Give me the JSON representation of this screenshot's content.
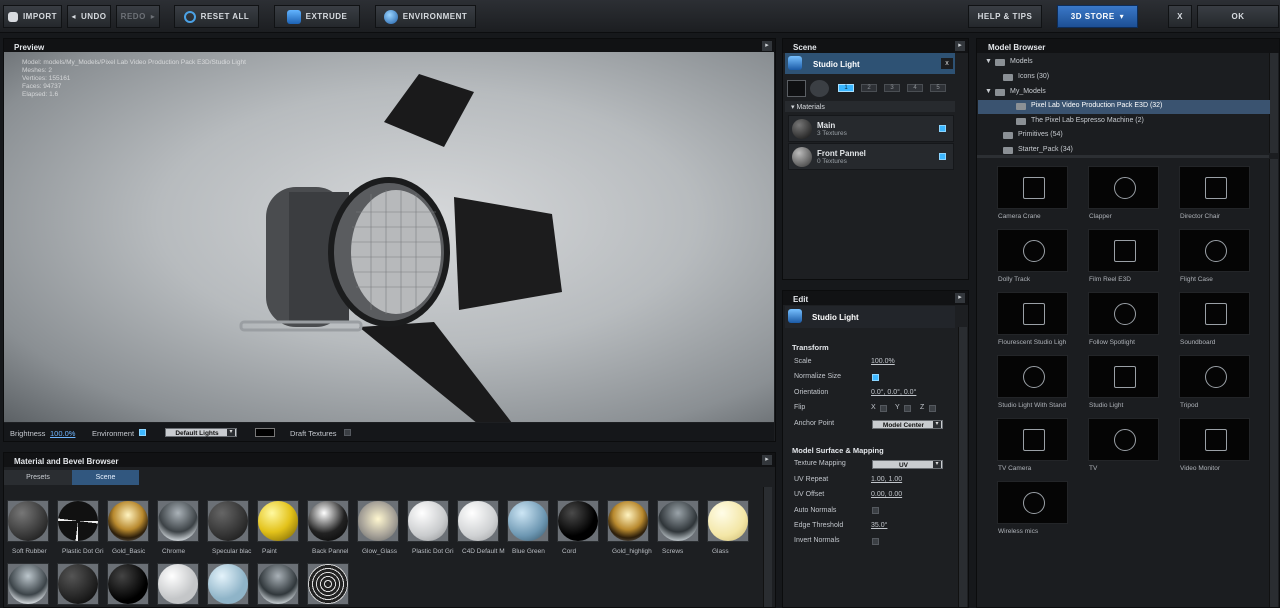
{
  "toolbar": {
    "import": "IMPORT",
    "undo": "UNDO",
    "redo": "REDO",
    "reset_all": "RESET ALL",
    "extrude": "EXTRUDE",
    "environment": "ENVIRONMENT",
    "help": "HELP & TIPS",
    "store": "3D STORE",
    "close": "X",
    "ok": "OK"
  },
  "preview": {
    "title": "Preview",
    "info": [
      "Model: models/My_Models/Pixel Lab Video Production Pack E3D/Studio Light",
      "Meshes: 2",
      "Vertices: 155161",
      "Faces: 94737",
      "Elapsed: 1.6"
    ],
    "brightness_label": "Brightness",
    "brightness_value": "100.0%",
    "environment_label": "Environment",
    "lights": "Default Lights",
    "draft_label": "Draft Textures"
  },
  "materials": {
    "title": "Material and Bevel Browser",
    "tabs": [
      "Presets",
      "Scene"
    ],
    "row1": [
      "Soft Rubber",
      "Plastic Dot Gri",
      "Gold_Basic",
      "Chrome",
      "Specular blac",
      "Paint",
      "Back Pannel",
      "Glow_Glass",
      "Plastic Dot Gri",
      "C4D Default M",
      "Blue Green",
      "Cord",
      "Gold_highligh",
      "Screws",
      "Glass"
    ]
  },
  "scene": {
    "title": "Scene",
    "object": "Studio Light",
    "close": "x",
    "tabs": [
      "1",
      "2",
      "3",
      "4",
      "5"
    ],
    "materials_header": "Materials",
    "items": [
      {
        "name": "Main",
        "sub": "3 Textures"
      },
      {
        "name": "Front Pannel",
        "sub": "0 Textures"
      }
    ]
  },
  "edit": {
    "title": "Edit",
    "object": "Studio Light",
    "transform": "Transform",
    "scale_label": "Scale",
    "scale": "100.0%",
    "normalize_label": "Normalize Size",
    "orientation_label": "Orientation",
    "orientation": "0.0°, 0.0°, 0.0°",
    "flip_label": "Flip",
    "flip_x": "X",
    "flip_y": "Y",
    "flip_z": "Z",
    "anchor_label": "Anchor Point",
    "anchor": "Model Center",
    "surface": "Model Surface & Mapping",
    "tex_label": "Texture Mapping",
    "tex": "UV",
    "uvrep_label": "UV Repeat",
    "uvrep": "1.00, 1.00",
    "uvoff_label": "UV Offset",
    "uvoff": "0.00, 0.00",
    "auto_label": "Auto Normals",
    "edge_label": "Edge Threshold",
    "edge": "35.0°",
    "invert_label": "Invert Normals"
  },
  "browser": {
    "title": "Model Browser",
    "tree": [
      "Models",
      "Icons (30)",
      "My_Models",
      "Pixel Lab Video Production Pack E3D (32)",
      "The Pixel Lab Espresso Machine (2)",
      "Primitives (54)",
      "Starter_Pack (34)"
    ],
    "models": [
      "Camera Crane",
      "Clapper",
      "Director Chair",
      "Dolly Track",
      "Film Reel E3D",
      "Flight Case",
      "Flourescent Studio Ligh",
      "Follow Spotlight",
      "Soundboard",
      "Studio Light With Stand",
      "Studio Light",
      "Tripod",
      "TV Camera",
      "TV",
      "Video Monitor",
      "Wireless mics"
    ]
  }
}
